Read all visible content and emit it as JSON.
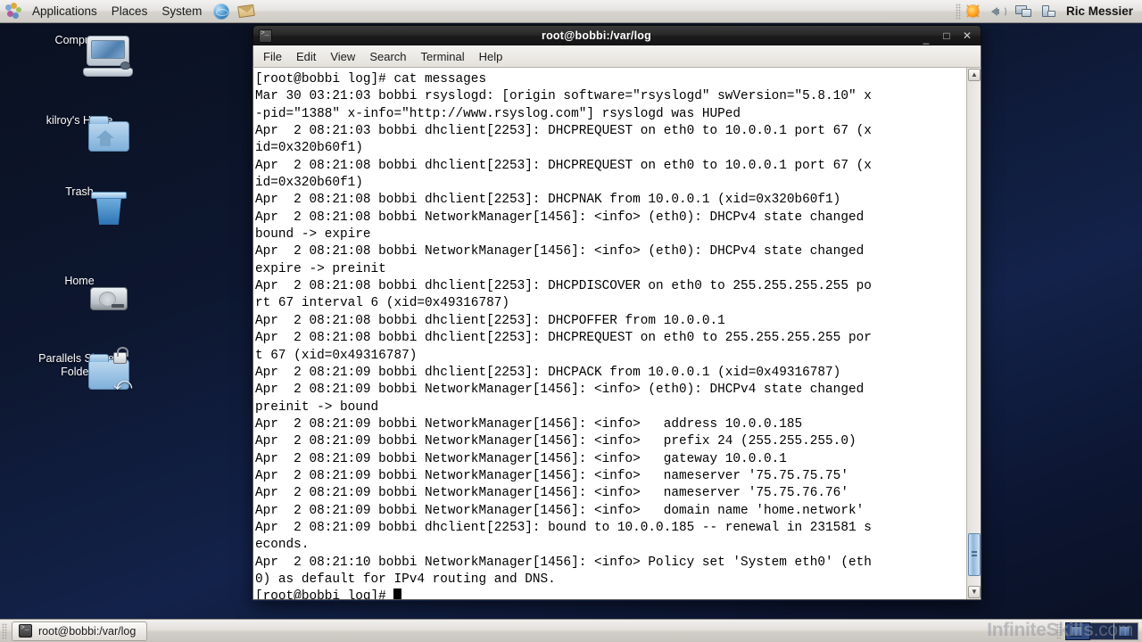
{
  "top_panel": {
    "logo": "gnome-foot-logo",
    "menus": [
      "Applications",
      "Places",
      "System"
    ],
    "launchers": [
      {
        "name": "web-browser-icon"
      },
      {
        "name": "email-client-icon"
      }
    ],
    "tray": [
      {
        "name": "update-notifier-icon"
      },
      {
        "name": "volume-icon"
      },
      {
        "name": "network-icon"
      },
      {
        "name": "power-manager-icon"
      }
    ],
    "user": "Ric Messier"
  },
  "desktop_icons": [
    {
      "name": "computer",
      "label": "Computer",
      "icon": "computer-icon"
    },
    {
      "name": "kilroys-home",
      "label": "kilroy's Home",
      "icon": "home-folder-icon"
    },
    {
      "name": "trash",
      "label": "Trash",
      "icon": "trash-icon"
    },
    {
      "name": "home",
      "label": "Home",
      "icon": "hard-drive-icon"
    },
    {
      "name": "parallels-shared-folders",
      "label": "Parallels Shared\nFolders",
      "label_line1": "Parallels Shared",
      "label_line2": "Folders",
      "icon": "shared-folder-locked-icon"
    }
  ],
  "terminal": {
    "title": "root@bobbi:/var/log",
    "window_icon": "terminal-icon",
    "window_buttons": {
      "minimize": "_",
      "maximize": "□",
      "close": "✕"
    },
    "menu": [
      "File",
      "Edit",
      "View",
      "Search",
      "Terminal",
      "Help"
    ],
    "scrollbar": {
      "up_arrow": "▲",
      "down_arrow": "▼"
    },
    "lines": [
      "[root@bobbi log]# cat messages",
      "Mar 30 03:21:03 bobbi rsyslogd: [origin software=\"rsyslogd\" swVersion=\"5.8.10\" x",
      "-pid=\"1388\" x-info=\"http://www.rsyslog.com\"] rsyslogd was HUPed",
      "Apr  2 08:21:03 bobbi dhclient[2253]: DHCPREQUEST on eth0 to 10.0.0.1 port 67 (x",
      "id=0x320b60f1)",
      "Apr  2 08:21:08 bobbi dhclient[2253]: DHCPREQUEST on eth0 to 10.0.0.1 port 67 (x",
      "id=0x320b60f1)",
      "Apr  2 08:21:08 bobbi dhclient[2253]: DHCPNAK from 10.0.0.1 (xid=0x320b60f1)",
      "Apr  2 08:21:08 bobbi NetworkManager[1456]: <info> (eth0): DHCPv4 state changed",
      "bound -> expire",
      "Apr  2 08:21:08 bobbi NetworkManager[1456]: <info> (eth0): DHCPv4 state changed",
      "expire -> preinit",
      "Apr  2 08:21:08 bobbi dhclient[2253]: DHCPDISCOVER on eth0 to 255.255.255.255 po",
      "rt 67 interval 6 (xid=0x49316787)",
      "Apr  2 08:21:08 bobbi dhclient[2253]: DHCPOFFER from 10.0.0.1",
      "Apr  2 08:21:08 bobbi dhclient[2253]: DHCPREQUEST on eth0 to 255.255.255.255 por",
      "t 67 (xid=0x49316787)",
      "Apr  2 08:21:09 bobbi dhclient[2253]: DHCPACK from 10.0.0.1 (xid=0x49316787)",
      "Apr  2 08:21:09 bobbi NetworkManager[1456]: <info> (eth0): DHCPv4 state changed",
      "preinit -> bound",
      "Apr  2 08:21:09 bobbi NetworkManager[1456]: <info>   address 10.0.0.185",
      "Apr  2 08:21:09 bobbi NetworkManager[1456]: <info>   prefix 24 (255.255.255.0)",
      "Apr  2 08:21:09 bobbi NetworkManager[1456]: <info>   gateway 10.0.0.1",
      "Apr  2 08:21:09 bobbi NetworkManager[1456]: <info>   nameserver '75.75.75.75'",
      "Apr  2 08:21:09 bobbi NetworkManager[1456]: <info>   nameserver '75.75.76.76'",
      "Apr  2 08:21:09 bobbi NetworkManager[1456]: <info>   domain name 'home.network'",
      "Apr  2 08:21:09 bobbi dhclient[2253]: bound to 10.0.0.185 -- renewal in 231581 s",
      "econds.",
      "Apr  2 08:21:10 bobbi NetworkManager[1456]: <info> Policy set 'System eth0' (eth",
      "0) as default for IPv4 routing and DNS."
    ],
    "prompt": "[root@bobbi log]# "
  },
  "bottom_panel": {
    "task_button": {
      "label": "root@bobbi:/var/log",
      "icon": "terminal-icon"
    },
    "workspaces": [
      {
        "name": "workspace-1",
        "active": true,
        "has_window": true
      },
      {
        "name": "workspace-2",
        "active": false,
        "has_window": false
      },
      {
        "name": "workspace-3",
        "active": false,
        "has_window": true
      }
    ]
  },
  "watermark": {
    "brand": "InfiniteSkills",
    "tld": ".com"
  },
  "colors": {
    "desktop_bg_dark": "#0a1020",
    "desktop_bg_mid": "#13224a",
    "panel_bg": "#e3e0dc",
    "titlebar_bg": "#1c1c1c",
    "terminal_bg": "#ffffff",
    "terminal_fg": "#000000",
    "scroll_thumb": "#8fb5da"
  }
}
